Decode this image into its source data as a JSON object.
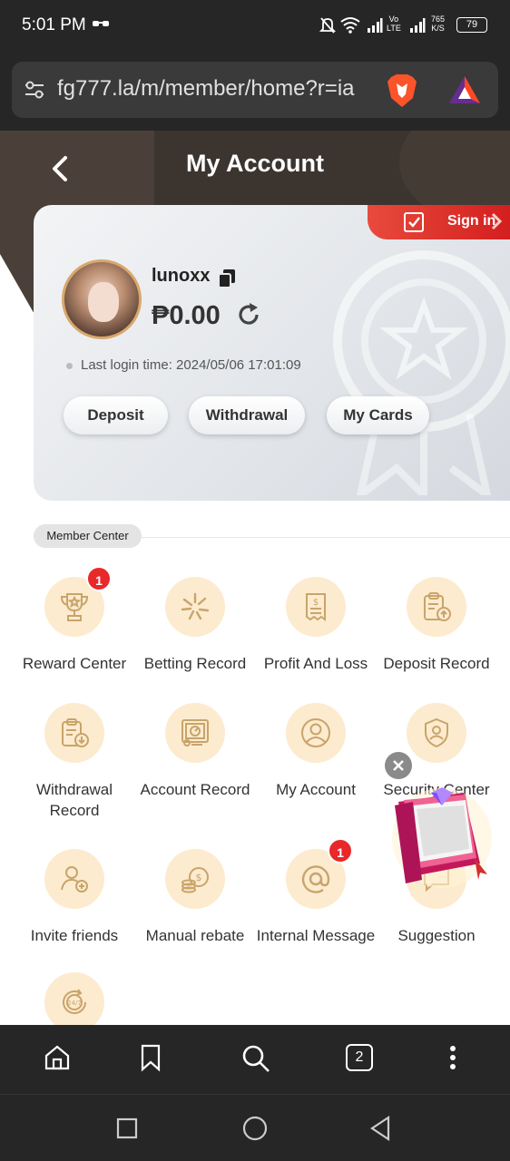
{
  "status": {
    "time": "5:01 PM",
    "network_top": "765",
    "network_bottom": "K/S",
    "volte_top": "Vo",
    "volte_bottom": "LTE",
    "battery": "79"
  },
  "browser": {
    "url": "fg777.la/m/member/home?r=ia",
    "tab_count": "2"
  },
  "header": {
    "title": "My Account"
  },
  "account": {
    "sign_in_label": "Sign in",
    "username": "lunoxx",
    "balance": "₱0.00",
    "last_login": "Last login time: 2024/05/06 17:01:09",
    "buttons": {
      "deposit": "Deposit",
      "withdrawal": "Withdrawal",
      "my_cards": "My Cards"
    }
  },
  "member_center": {
    "label": "Member Center",
    "items": [
      {
        "label": "Reward Center",
        "icon": "trophy-icon",
        "badge": "1"
      },
      {
        "label": "Betting Record",
        "icon": "sparkle-icon"
      },
      {
        "label": "Profit And Loss",
        "icon": "receipt-icon"
      },
      {
        "label": "Deposit Record",
        "icon": "clipboard-upload-icon"
      },
      {
        "label": "Withdrawal\nRecord",
        "icon": "clipboard-download-icon"
      },
      {
        "label": "Account Record",
        "icon": "chart-board-icon"
      },
      {
        "label": "My Account",
        "icon": "user-icon"
      },
      {
        "label": "Security Center",
        "icon": "shield-user-icon"
      },
      {
        "label": "Invite friends",
        "icon": "add-user-icon"
      },
      {
        "label": "Manual rebate",
        "icon": "coins-icon"
      },
      {
        "label": "Internal Message",
        "icon": "at-icon",
        "badge": "1"
      },
      {
        "label": "Suggestion",
        "icon": "chat-icon"
      },
      {
        "label": "",
        "icon": "support-247-icon"
      }
    ]
  },
  "colors": {
    "header_bg": "#3b342f",
    "accent_red": "#e8282a",
    "icon_circle": "#fcebcf",
    "icon_stroke": "#c9a46a"
  }
}
